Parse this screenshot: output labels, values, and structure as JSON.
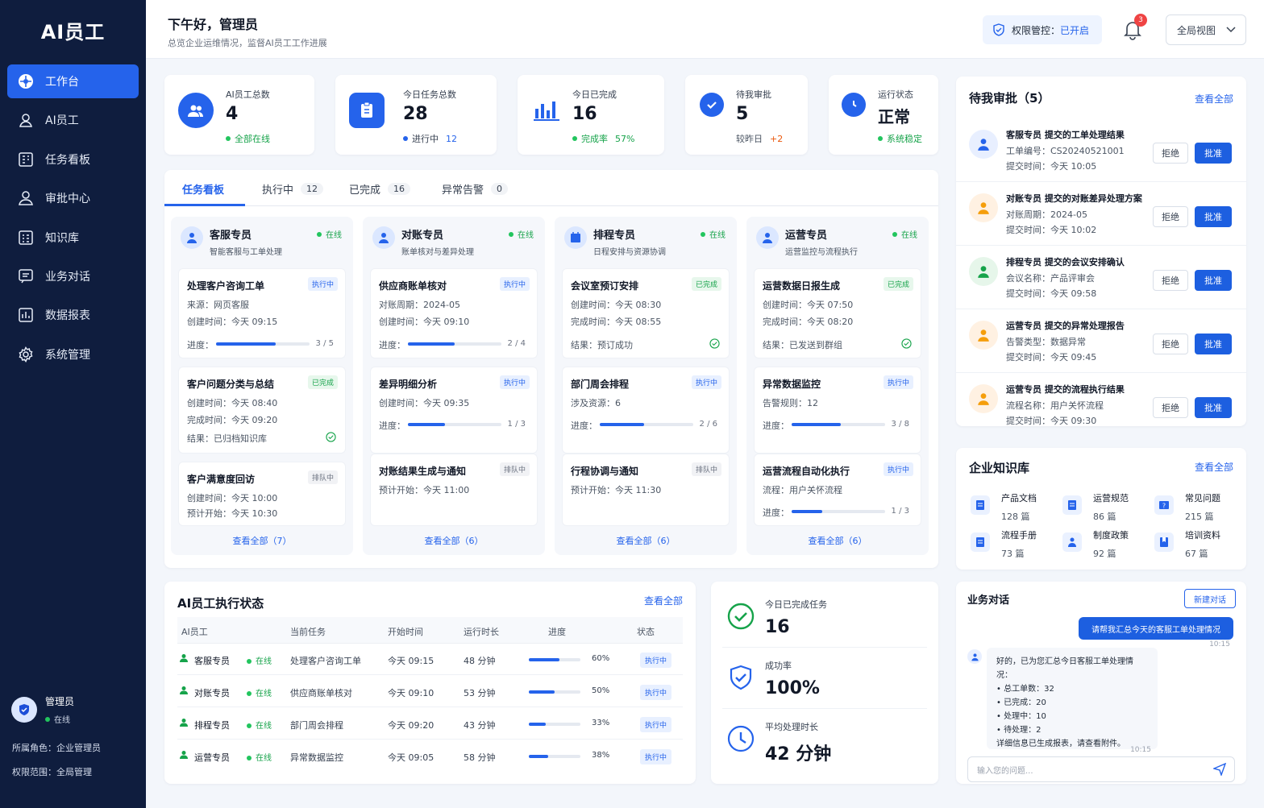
{
  "sidebar": {
    "logo": "AI员工",
    "items": [
      {
        "label": "工作台",
        "icon": "dashboard-icon"
      },
      {
        "label": "AI员工",
        "icon": "user-robot-icon"
      },
      {
        "label": "任务看板",
        "icon": "kanban-icon"
      },
      {
        "label": "审批中心",
        "icon": "user-icon"
      },
      {
        "label": "知识库",
        "icon": "grid-icon"
      },
      {
        "label": "业务对话",
        "icon": "chat-icon"
      },
      {
        "label": "数据报表",
        "icon": "chart-icon"
      },
      {
        "label": "系统管理",
        "icon": "gear-icon"
      }
    ],
    "user": {
      "name": "管理员",
      "status": "在线"
    },
    "role": "所属角色：企业管理员",
    "scope": "权限范围：全局管理"
  },
  "header": {
    "greeting": "下午好，管理员",
    "subtitle": "总览企业运维情况，监督AI员工工作进展",
    "perm_label": "权限管控：",
    "perm_value": "已开启",
    "bell_count": "3",
    "view": "全局视图"
  },
  "stats": [
    {
      "label": "AI员工总数",
      "value": "4",
      "sub": "全部在线"
    },
    {
      "label": "今日任务总数",
      "value": "28",
      "sub_label": "进行中",
      "sub_value": "12"
    },
    {
      "label": "今日已完成",
      "value": "16",
      "sub_label": "完成率",
      "sub_value": "57%"
    },
    {
      "label": "待我审批",
      "value": "5",
      "sub_label": "较昨日",
      "sub_value": "+2"
    },
    {
      "label": "运行状态",
      "value": "正常",
      "sub": "系统稳定"
    }
  ],
  "tabs": [
    {
      "label": "任务看板"
    },
    {
      "label": "执行中",
      "count": "12"
    },
    {
      "label": "已完成",
      "count": "16"
    },
    {
      "label": "异常告警",
      "count": "0"
    }
  ],
  "columns": [
    {
      "name": "客服专员",
      "desc": "智能客服与工单处理",
      "online": "在线",
      "more": "查看全部（7）",
      "tasks": [
        {
          "title": "处理客户咨询工单",
          "tag": "执行中",
          "l1": "来源：网页客服",
          "l2": "创建时间：今天 09:15",
          "prog": "进度：",
          "count": "3 / 5"
        },
        {
          "title": "客户问题分类与总结",
          "tag": "已完成",
          "l1": "创建时间：今天 08:40",
          "l2": "完成时间：今天 09:20",
          "l3": "结果：已归档知识库"
        },
        {
          "title": "客户满意度回访",
          "tag": "排队中",
          "l1": "创建时间：今天 10:00",
          "l2": "预计开始：今天 10:30"
        }
      ]
    },
    {
      "name": "对账专员",
      "desc": "账单核对与差异处理",
      "online": "在线",
      "more": "查看全部（6）",
      "tasks": [
        {
          "title": "供应商账单核对",
          "tag": "执行中",
          "l1": "对账周期：2024-05",
          "l2": "创建时间：今天 09:10",
          "prog": "进度：",
          "count": "2 / 4"
        },
        {
          "title": "差异明细分析",
          "tag": "执行中",
          "l1": "创建时间：今天 09:35",
          "prog": "进度：",
          "count": "1 / 3"
        },
        {
          "title": "对账结果生成与通知",
          "tag": "排队中",
          "l1": "预计开始：今天 11:00"
        }
      ]
    },
    {
      "name": "排程专员",
      "desc": "日程安排与资源协调",
      "online": "在线",
      "more": "查看全部（6）",
      "tasks": [
        {
          "title": "会议室预订安排",
          "tag": "已完成",
          "l1": "创建时间：今天 08:30",
          "l2": "完成时间：今天 08:55",
          "l3": "结果：预订成功"
        },
        {
          "title": "部门周会排程",
          "tag": "执行中",
          "l1": "涉及资源：6",
          "prog": "进度：",
          "count": "2 / 6"
        },
        {
          "title": "行程协调与通知",
          "tag": "排队中",
          "l1": "预计开始：今天 11:30"
        }
      ]
    },
    {
      "name": "运营专员",
      "desc": "运营监控与流程执行",
      "online": "在线",
      "more": "查看全部（6）",
      "tasks": [
        {
          "title": "运营数据日报生成",
          "tag": "已完成",
          "l1": "创建时间：今天 07:50",
          "l2": "完成时间：今天 08:20",
          "l3": "结果：已发送到群组"
        },
        {
          "title": "异常数据监控",
          "tag": "执行中",
          "l1": "告警规则：12",
          "prog": "进度：",
          "count": "3 / 8"
        },
        {
          "title": "运营流程自动化执行",
          "tag": "执行中",
          "l1": "流程：用户关怀流程",
          "prog": "进度：",
          "count": "1 / 3"
        }
      ]
    }
  ],
  "approvals": {
    "title": "待我审批（5）",
    "link": "查看全部",
    "reject": "拒绝",
    "approve": "批准",
    "items": [
      {
        "title": "客服专员  提交的工单处理结果",
        "l1": "工单编号：CS20240521001",
        "l2": "提交时间：今天 10:05"
      },
      {
        "title": "对账专员  提交的对账差异处理方案",
        "l1": "对账周期：2024-05",
        "l2": "提交时间：今天 10:02"
      },
      {
        "title": "排程专员  提交的会议安排确认",
        "l1": "会议名称：产品评审会",
        "l2": "提交时间：今天 09:58"
      },
      {
        "title": "运营专员  提交的异常处理报告",
        "l1": "告警类型：数据异常",
        "l2": "提交时间：今天 09:45"
      },
      {
        "title": "运营专员  提交的流程执行结果",
        "l1": "流程名称：用户关怀流程",
        "l2": "提交时间：今天 09:30"
      }
    ]
  },
  "knowledge": {
    "title": "企业知识库",
    "link": "查看全部",
    "items": [
      {
        "name": "产品文档",
        "count": "128 篇"
      },
      {
        "name": "运营规范",
        "count": "86 篇"
      },
      {
        "name": "常见问题",
        "count": "215 篇"
      },
      {
        "name": "流程手册",
        "count": "73 篇"
      },
      {
        "name": "制度政策",
        "count": "92 篇"
      },
      {
        "name": "培训资料",
        "count": "67 篇"
      }
    ]
  },
  "exec": {
    "title": "AI员工执行状态",
    "link": "查看全部",
    "headers": [
      "AI员工",
      "当前任务",
      "开始时间",
      "运行时长",
      "进度",
      "状态"
    ],
    "rows": [
      {
        "name": "客服专员",
        "online": "在线",
        "task": "处理客户咨询工单",
        "start": "今天 09:15",
        "dur": "48 分钟",
        "pct": "60%",
        "status": "执行中"
      },
      {
        "name": "对账专员",
        "online": "在线",
        "task": "供应商账单核对",
        "start": "今天 09:10",
        "dur": "53 分钟",
        "pct": "50%",
        "status": "执行中"
      },
      {
        "name": "排程专员",
        "online": "在线",
        "task": "部门周会排程",
        "start": "今天 09:20",
        "dur": "43 分钟",
        "pct": "33%",
        "status": "执行中"
      },
      {
        "name": "运营专员",
        "online": "在线",
        "task": "异常数据监控",
        "start": "今天 09:05",
        "dur": "58 分钟",
        "pct": "38%",
        "status": "执行中"
      }
    ]
  },
  "summary": [
    {
      "label": "今日已完成任务",
      "value": "16"
    },
    {
      "label": "成功率",
      "value": "100%"
    },
    {
      "label": "平均处理时长",
      "value": "42 分钟"
    }
  ],
  "chat": {
    "title": "业务对话",
    "new_btn": "新建对话",
    "user_msg": "请帮我汇总今天的客服工单处理情况",
    "user_time": "10:15",
    "reply_intro": "好的，已为您汇总今日客服工单处理情况：",
    "reply_items": [
      "总工单数：32",
      "已完成：20",
      "处理中：10",
      "待处理：2"
    ],
    "reply_outro": "详细信息已生成报表，请查看附件。",
    "reply_time": "10:15",
    "placeholder": "输入您的问题..."
  }
}
